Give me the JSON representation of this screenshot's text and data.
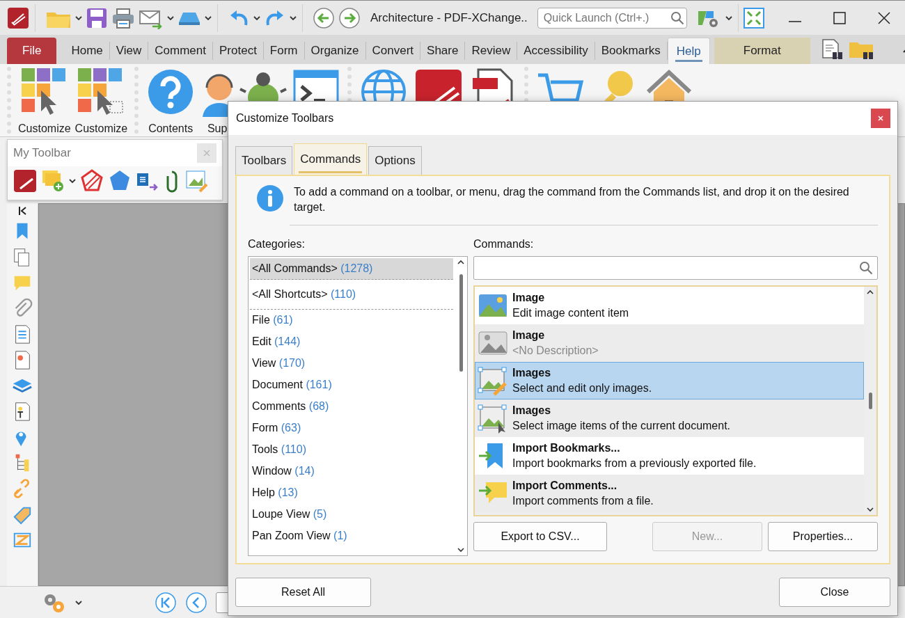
{
  "window": {
    "title": "Architecture - PDF-XChange..",
    "quick_launch": {
      "placeholder": "Quick Launch (Ctrl+.)"
    }
  },
  "ribbon_tabs": [
    {
      "label": "File",
      "kind": "file",
      "selected": false
    },
    {
      "label": "Home",
      "kind": "tab",
      "selected": false
    },
    {
      "label": "View",
      "kind": "tab",
      "selected": false
    },
    {
      "label": "Comment",
      "kind": "tab",
      "selected": false
    },
    {
      "label": "Protect",
      "kind": "tab",
      "selected": false
    },
    {
      "label": "Form",
      "kind": "tab",
      "selected": false
    },
    {
      "label": "Organize",
      "kind": "tab",
      "selected": false
    },
    {
      "label": "Convert",
      "kind": "tab",
      "selected": false
    },
    {
      "label": "Share",
      "kind": "tab",
      "selected": false
    },
    {
      "label": "Review",
      "kind": "tab",
      "selected": false
    },
    {
      "label": "Accessibility",
      "kind": "tab",
      "selected": false
    },
    {
      "label": "Bookmarks",
      "kind": "tab",
      "selected": false
    },
    {
      "label": "Help",
      "kind": "tab",
      "selected": true
    },
    {
      "label": "Format",
      "kind": "context",
      "selected": false
    }
  ],
  "ribbon_buttons": [
    {
      "label": "Customize"
    },
    {
      "label": "Customize"
    },
    {
      "label": "Contents"
    },
    {
      "label": "Sup"
    }
  ],
  "my_toolbar": {
    "title": "My Toolbar"
  },
  "dialog": {
    "title": "Customize Toolbars",
    "tabs": [
      {
        "label": "Toolbars",
        "selected": false
      },
      {
        "label": "Commands",
        "selected": true
      },
      {
        "label": "Options",
        "selected": false
      }
    ],
    "info": "To add a command on a toolbar, or menu, drag the command from the Commands list, and drop it on the desired target.",
    "categories_label": "Categories:",
    "categories": [
      {
        "name": "<All Commands>",
        "count": "(1278)",
        "kind": "special",
        "selected": true
      },
      {
        "name": "<All Shortcuts>",
        "count": "(110)",
        "kind": "special",
        "selected": false
      },
      {
        "name": "File",
        "count": "(61)",
        "kind": "normal",
        "selected": false
      },
      {
        "name": "Edit",
        "count": "(144)",
        "kind": "normal",
        "selected": false
      },
      {
        "name": "View",
        "count": "(170)",
        "kind": "normal",
        "selected": false
      },
      {
        "name": "Document",
        "count": "(161)",
        "kind": "normal",
        "selected": false
      },
      {
        "name": "Comments",
        "count": "(68)",
        "kind": "normal",
        "selected": false
      },
      {
        "name": "Form",
        "count": "(63)",
        "kind": "normal",
        "selected": false
      },
      {
        "name": "Tools",
        "count": "(110)",
        "kind": "normal",
        "selected": false
      },
      {
        "name": "Window",
        "count": "(14)",
        "kind": "normal",
        "selected": false
      },
      {
        "name": "Help",
        "count": "(13)",
        "kind": "normal",
        "selected": false
      },
      {
        "name": "Loupe View",
        "count": "(5)",
        "kind": "normal",
        "selected": false
      },
      {
        "name": "Pan Zoom View",
        "count": "(1)",
        "kind": "normal",
        "selected": false
      }
    ],
    "commands_label": "Commands:",
    "commands": [
      {
        "title": "Image",
        "description": "Edit image content item",
        "kind": "picture",
        "description_muted": false,
        "selected": false
      },
      {
        "title": "Image",
        "description": "<No Description>",
        "kind": "placeholder",
        "description_muted": true,
        "selected": false
      },
      {
        "title": "Images",
        "description": "Select and edit only images.",
        "kind": "picture-edit",
        "description_muted": false,
        "selected": true
      },
      {
        "title": "Images",
        "description": "Select image items of the current document.",
        "kind": "picture-select",
        "description_muted": false,
        "selected": false
      },
      {
        "title": "Import Bookmarks...",
        "description": "Import bookmarks from a previously exported file.",
        "kind": "bookmarks",
        "description_muted": false,
        "selected": false
      },
      {
        "title": "Import Comments...",
        "description": "Import comments from a file.",
        "kind": "comments",
        "description_muted": false,
        "selected": false
      }
    ],
    "buttons": [
      {
        "label": "Export to CSV...",
        "disabled": false
      },
      {
        "label": "New...",
        "disabled": true
      },
      {
        "label": "Properties...",
        "disabled": false
      }
    ],
    "footer_buttons": [
      {
        "label": "Reset All"
      },
      {
        "label": "Close"
      }
    ]
  }
}
